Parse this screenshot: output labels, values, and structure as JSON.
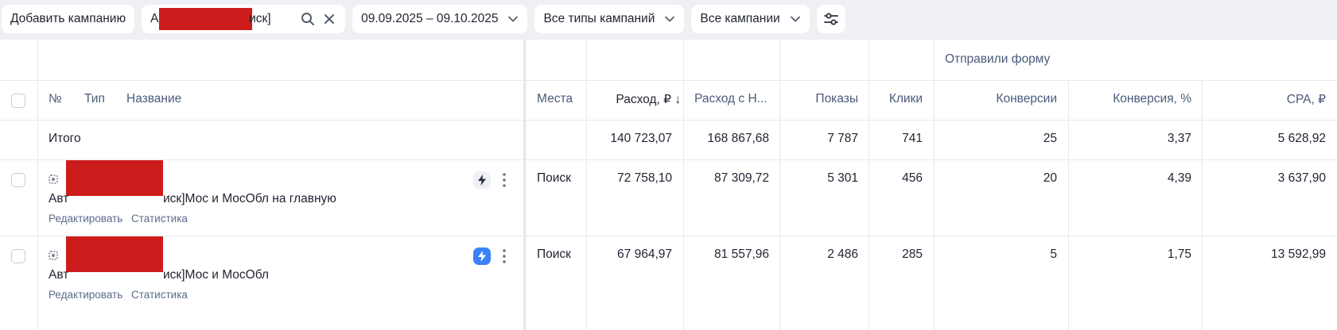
{
  "toolbar": {
    "add_campaign": "Добавить кампанию",
    "search_prefix": "А",
    "search_suffix": "иск]",
    "date_range": "09.09.2025 – 09.10.2025",
    "types_filter": "Все типы кампаний",
    "campaigns_filter": "Все кампании"
  },
  "table": {
    "group_header": "Отправили форму",
    "headers": {
      "number": "№",
      "type": "Тип",
      "name": "Название",
      "places": "Места",
      "spend": "Расход, ₽ ↓",
      "spend_vat": "Расход с Н...",
      "impressions": "Показы",
      "clicks": "Клики",
      "conversions": "Конверсии",
      "conversion_rate": "Конверсия, %",
      "cpa": "CPA, ₽"
    },
    "total": {
      "label": "Итого",
      "spend": "140 723,07",
      "spend_vat": "168 867,68",
      "impressions": "7 787",
      "clicks": "741",
      "conversions": "25",
      "conversion_rate": "3,37",
      "cpa": "5 628,92"
    },
    "rows": [
      {
        "name_prefix": "Авт",
        "name_suffix": "иск]Мос и МосОбл на главную",
        "edit": "Редактировать",
        "stats": "Статистика",
        "places": "Поиск",
        "spend": "72 758,10",
        "spend_vat": "87 309,72",
        "impressions": "5 301",
        "clicks": "456",
        "conversions": "20",
        "conversion_rate": "4,39",
        "cpa": "3 637,90"
      },
      {
        "name_prefix": "Авт",
        "name_suffix": "иск]Мос и МосОбл",
        "edit": "Редактировать",
        "stats": "Статистика",
        "places": "Поиск",
        "spend": "67 964,97",
        "spend_vat": "81 557,96",
        "impressions": "2 486",
        "clicks": "285",
        "conversions": "5",
        "conversion_rate": "1,75",
        "cpa": "13 592,99"
      }
    ]
  },
  "colors": {
    "background": "#eef0f4",
    "redaction": "#cd1c1c",
    "accent": "#3b82f6"
  }
}
